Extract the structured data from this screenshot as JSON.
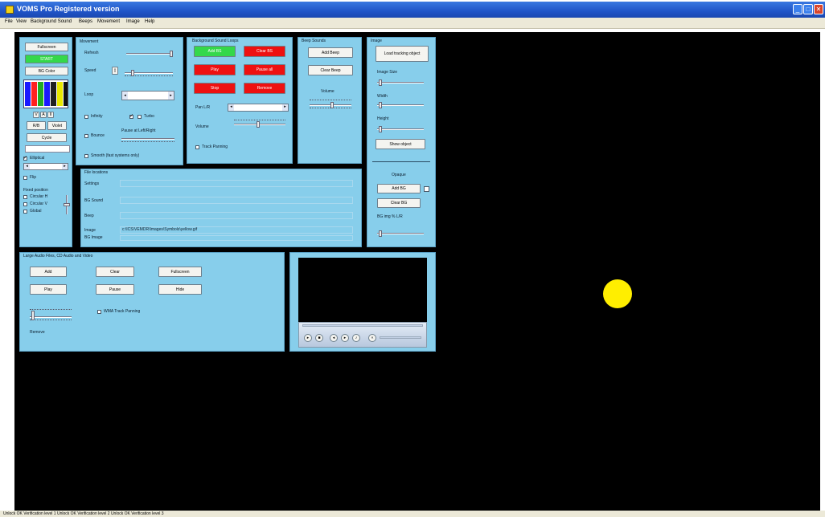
{
  "window": {
    "title": "VOMS Pro Registered version",
    "caption_buttons": [
      "minimize",
      "maximize",
      "close"
    ]
  },
  "menu": [
    "File",
    "View",
    "Background Sound",
    "Beeps",
    "Movement",
    "Image",
    "Help"
  ],
  "left_panel": {
    "fullscreen": "Fullscreen",
    "start": "START",
    "bg_color": "BG Color",
    "colors": [
      "#1a1aff",
      "#101010",
      "#ff2020",
      "#22aa22",
      "#e8e800",
      "#202020"
    ],
    "small_buttons": [
      "V",
      "A",
      "II"
    ],
    "rb_label": "R/B",
    "violet_label": "Violet",
    "cycle_label": "Cycle",
    "elliptical_label": "Elliptical",
    "flip_label": "Flip",
    "fixed_position_label": "Fixed position",
    "circular_h_label": "Circular H",
    "circular_v_label": "Circular V",
    "global_label": "Global"
  },
  "movement": {
    "header": "Movement",
    "refresh": "Refresh",
    "speed": "Speed",
    "loop": "Loop",
    "infinity": "Infinity",
    "turbo": "Turbo",
    "bounce": "Bounce",
    "pause_lr": "Pause at Left/Right",
    "smooth": "Smooth (fast systems only)"
  },
  "bg_sound": {
    "header": "Background Sound Loops",
    "add_bs": "Add BS",
    "clear_bs": "Clear BS",
    "play": "Play",
    "pause_all": "Pause all",
    "stop": "Stop",
    "remove": "Remove",
    "pan_lr": "Pan L/R",
    "volume": "Volume",
    "track_panning": "Track Panning"
  },
  "beep_sounds": {
    "header": "Beep Sounds",
    "add_beep": "Add Beep",
    "clear_beep": "Clear Beep",
    "volume": "Volume"
  },
  "image_panel": {
    "header": "Image",
    "load_tracking": "Load tracking object",
    "image_size": "Image Size",
    "width": "Width",
    "height": "Height",
    "show_object": "Show object",
    "opaque": "Opaque",
    "add_bg": "Add BG",
    "clear_bg": "Clear BG",
    "bg_img_lr": "BG img % L/R"
  },
  "file_locations": {
    "header": "File locations",
    "settings": "Settings",
    "bg_sound": "BG Sound",
    "beep": "Beep",
    "image": "Image",
    "bg_image": "BG Image",
    "image_value": "c:\\ICS\\VEMDR\\Images\\Symbols\\yellow.gif"
  },
  "large_audio": {
    "header": "Large Audio Files, CD Audio and Video",
    "add": "Add",
    "clear": "Clear",
    "fullscreen": "Fullscreen",
    "play": "Play",
    "pause": "Pause",
    "hide": "Hide",
    "wma_panning": "WMA Track Panning",
    "remove": "Remove"
  },
  "status": "Unlock OK   Verification level 1   Unlock OK   Verification level 2   Unlock OK   Verification level 3",
  "tracking_dot_color": "#ffee00"
}
